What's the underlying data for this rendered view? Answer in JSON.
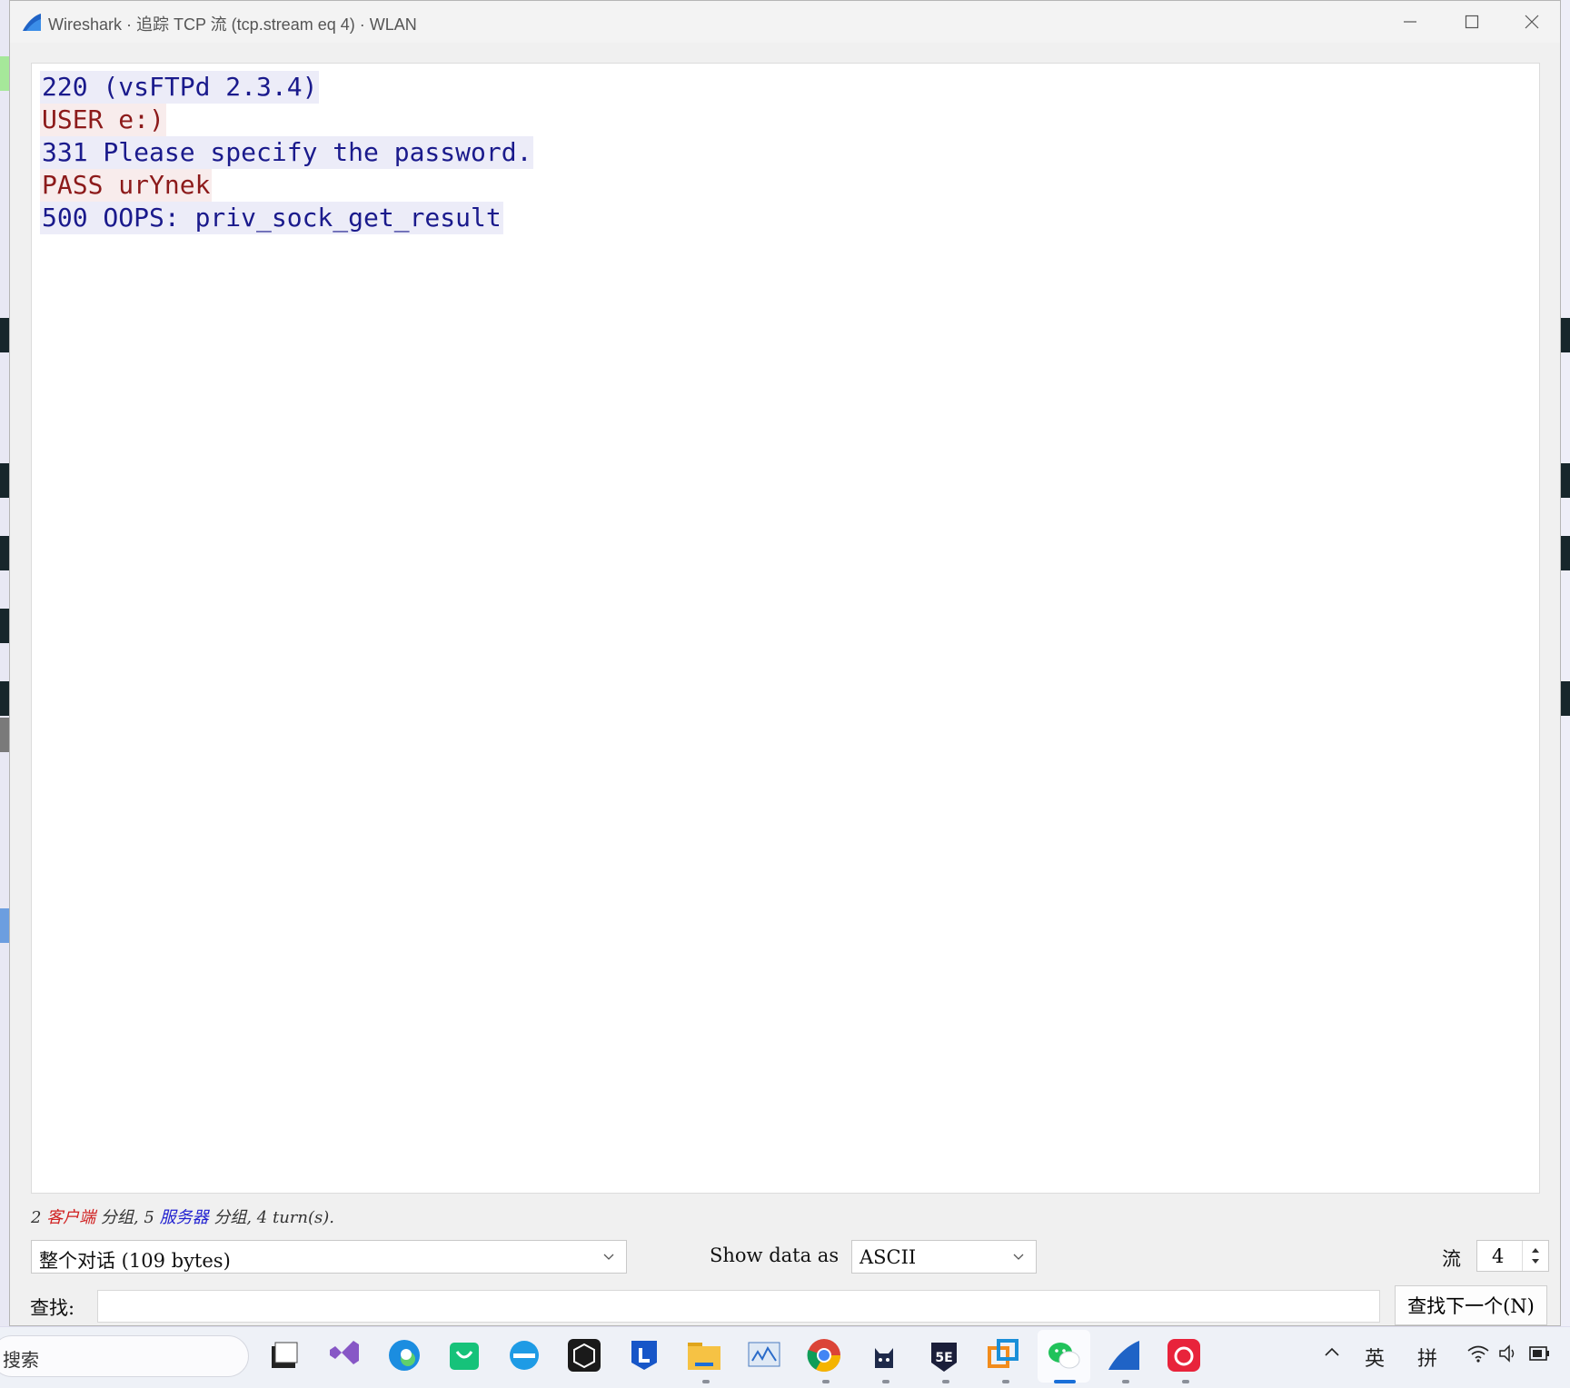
{
  "window": {
    "title": "Wireshark · 追踪 TCP 流 (tcp.stream eq 4) · WLAN",
    "buttons": [
      "minimize",
      "maximize",
      "close"
    ]
  },
  "stream_lines": [
    {
      "text": "220 (vsFTPd 2.3.4)",
      "side": "server"
    },
    {
      "text": "USER e:)",
      "side": "client"
    },
    {
      "text": "331 Please specify the password.",
      "side": "server"
    },
    {
      "text": "PASS urYnek",
      "side": "client"
    },
    {
      "text": "500 OOPS: priv_sock_get_result",
      "side": "server"
    }
  ],
  "summary": {
    "client_count": "2",
    "client_label": "客户端",
    "packets1": "分组,",
    "server_count": "5",
    "server_label": "服务器",
    "packets2": "分组,",
    "turns": "4 turn(s)."
  },
  "controls": {
    "conversation_select": "整个对话 (109 bytes)",
    "show_data_as_label": "Show data as",
    "format_select": "ASCII",
    "stream_label": "流",
    "stream_value": "4",
    "find_label": "查找:",
    "find_value": "",
    "find_next_button": "查找下一个(N)"
  },
  "taskbar": {
    "search_text": "搜索",
    "tray": {
      "ime_lang": "英",
      "ime_mode": "拼"
    },
    "apps": [
      "file-manager-icon",
      "visual-studio-icon",
      "edge-icon",
      "store-bag-icon",
      "ie-icon",
      "unity-icon",
      "lenovo-icon",
      "explorer-folder-icon",
      "monitor-icon",
      "chrome-icon",
      "cat-app-icon",
      "5e-icon",
      "vmware-icon",
      "wechat-icon",
      "wireshark-icon",
      "netease-music-icon"
    ]
  },
  "colors": {
    "server_text": "#1a1a8c",
    "server_bg": "#ececf8",
    "client_text": "#8c1a1a",
    "client_bg": "#f8ecec"
  }
}
